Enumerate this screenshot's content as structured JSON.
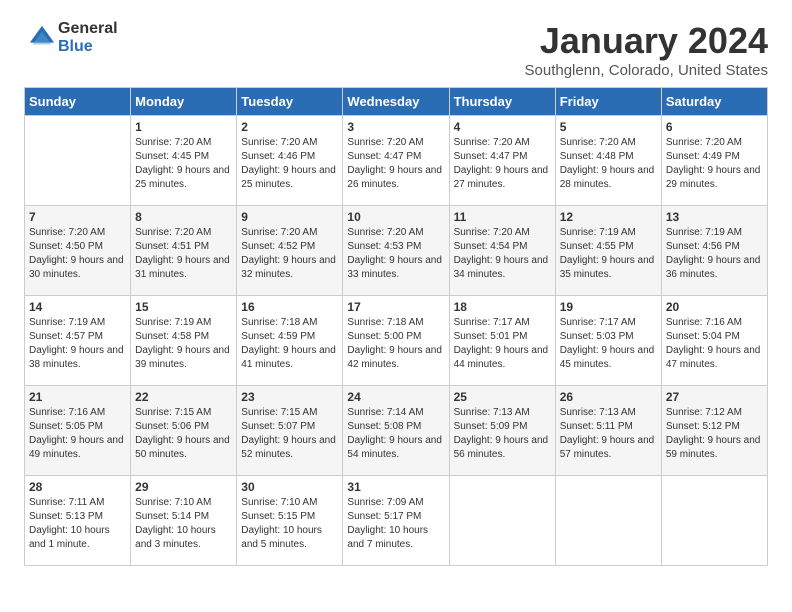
{
  "logo": {
    "general": "General",
    "blue": "Blue"
  },
  "header": {
    "month": "January 2024",
    "location": "Southglenn, Colorado, United States"
  },
  "weekdays": [
    "Sunday",
    "Monday",
    "Tuesday",
    "Wednesday",
    "Thursday",
    "Friday",
    "Saturday"
  ],
  "weeks": [
    [
      {
        "day": "",
        "sunrise": "",
        "sunset": "",
        "daylight": ""
      },
      {
        "day": "1",
        "sunrise": "Sunrise: 7:20 AM",
        "sunset": "Sunset: 4:45 PM",
        "daylight": "Daylight: 9 hours and 25 minutes."
      },
      {
        "day": "2",
        "sunrise": "Sunrise: 7:20 AM",
        "sunset": "Sunset: 4:46 PM",
        "daylight": "Daylight: 9 hours and 25 minutes."
      },
      {
        "day": "3",
        "sunrise": "Sunrise: 7:20 AM",
        "sunset": "Sunset: 4:47 PM",
        "daylight": "Daylight: 9 hours and 26 minutes."
      },
      {
        "day": "4",
        "sunrise": "Sunrise: 7:20 AM",
        "sunset": "Sunset: 4:47 PM",
        "daylight": "Daylight: 9 hours and 27 minutes."
      },
      {
        "day": "5",
        "sunrise": "Sunrise: 7:20 AM",
        "sunset": "Sunset: 4:48 PM",
        "daylight": "Daylight: 9 hours and 28 minutes."
      },
      {
        "day": "6",
        "sunrise": "Sunrise: 7:20 AM",
        "sunset": "Sunset: 4:49 PM",
        "daylight": "Daylight: 9 hours and 29 minutes."
      }
    ],
    [
      {
        "day": "7",
        "sunrise": "Sunrise: 7:20 AM",
        "sunset": "Sunset: 4:50 PM",
        "daylight": "Daylight: 9 hours and 30 minutes."
      },
      {
        "day": "8",
        "sunrise": "Sunrise: 7:20 AM",
        "sunset": "Sunset: 4:51 PM",
        "daylight": "Daylight: 9 hours and 31 minutes."
      },
      {
        "day": "9",
        "sunrise": "Sunrise: 7:20 AM",
        "sunset": "Sunset: 4:52 PM",
        "daylight": "Daylight: 9 hours and 32 minutes."
      },
      {
        "day": "10",
        "sunrise": "Sunrise: 7:20 AM",
        "sunset": "Sunset: 4:53 PM",
        "daylight": "Daylight: 9 hours and 33 minutes."
      },
      {
        "day": "11",
        "sunrise": "Sunrise: 7:20 AM",
        "sunset": "Sunset: 4:54 PM",
        "daylight": "Daylight: 9 hours and 34 minutes."
      },
      {
        "day": "12",
        "sunrise": "Sunrise: 7:19 AM",
        "sunset": "Sunset: 4:55 PM",
        "daylight": "Daylight: 9 hours and 35 minutes."
      },
      {
        "day": "13",
        "sunrise": "Sunrise: 7:19 AM",
        "sunset": "Sunset: 4:56 PM",
        "daylight": "Daylight: 9 hours and 36 minutes."
      }
    ],
    [
      {
        "day": "14",
        "sunrise": "Sunrise: 7:19 AM",
        "sunset": "Sunset: 4:57 PM",
        "daylight": "Daylight: 9 hours and 38 minutes."
      },
      {
        "day": "15",
        "sunrise": "Sunrise: 7:19 AM",
        "sunset": "Sunset: 4:58 PM",
        "daylight": "Daylight: 9 hours and 39 minutes."
      },
      {
        "day": "16",
        "sunrise": "Sunrise: 7:18 AM",
        "sunset": "Sunset: 4:59 PM",
        "daylight": "Daylight: 9 hours and 41 minutes."
      },
      {
        "day": "17",
        "sunrise": "Sunrise: 7:18 AM",
        "sunset": "Sunset: 5:00 PM",
        "daylight": "Daylight: 9 hours and 42 minutes."
      },
      {
        "day": "18",
        "sunrise": "Sunrise: 7:17 AM",
        "sunset": "Sunset: 5:01 PM",
        "daylight": "Daylight: 9 hours and 44 minutes."
      },
      {
        "day": "19",
        "sunrise": "Sunrise: 7:17 AM",
        "sunset": "Sunset: 5:03 PM",
        "daylight": "Daylight: 9 hours and 45 minutes."
      },
      {
        "day": "20",
        "sunrise": "Sunrise: 7:16 AM",
        "sunset": "Sunset: 5:04 PM",
        "daylight": "Daylight: 9 hours and 47 minutes."
      }
    ],
    [
      {
        "day": "21",
        "sunrise": "Sunrise: 7:16 AM",
        "sunset": "Sunset: 5:05 PM",
        "daylight": "Daylight: 9 hours and 49 minutes."
      },
      {
        "day": "22",
        "sunrise": "Sunrise: 7:15 AM",
        "sunset": "Sunset: 5:06 PM",
        "daylight": "Daylight: 9 hours and 50 minutes."
      },
      {
        "day": "23",
        "sunrise": "Sunrise: 7:15 AM",
        "sunset": "Sunset: 5:07 PM",
        "daylight": "Daylight: 9 hours and 52 minutes."
      },
      {
        "day": "24",
        "sunrise": "Sunrise: 7:14 AM",
        "sunset": "Sunset: 5:08 PM",
        "daylight": "Daylight: 9 hours and 54 minutes."
      },
      {
        "day": "25",
        "sunrise": "Sunrise: 7:13 AM",
        "sunset": "Sunset: 5:09 PM",
        "daylight": "Daylight: 9 hours and 56 minutes."
      },
      {
        "day": "26",
        "sunrise": "Sunrise: 7:13 AM",
        "sunset": "Sunset: 5:11 PM",
        "daylight": "Daylight: 9 hours and 57 minutes."
      },
      {
        "day": "27",
        "sunrise": "Sunrise: 7:12 AM",
        "sunset": "Sunset: 5:12 PM",
        "daylight": "Daylight: 9 hours and 59 minutes."
      }
    ],
    [
      {
        "day": "28",
        "sunrise": "Sunrise: 7:11 AM",
        "sunset": "Sunset: 5:13 PM",
        "daylight": "Daylight: 10 hours and 1 minute."
      },
      {
        "day": "29",
        "sunrise": "Sunrise: 7:10 AM",
        "sunset": "Sunset: 5:14 PM",
        "daylight": "Daylight: 10 hours and 3 minutes."
      },
      {
        "day": "30",
        "sunrise": "Sunrise: 7:10 AM",
        "sunset": "Sunset: 5:15 PM",
        "daylight": "Daylight: 10 hours and 5 minutes."
      },
      {
        "day": "31",
        "sunrise": "Sunrise: 7:09 AM",
        "sunset": "Sunset: 5:17 PM",
        "daylight": "Daylight: 10 hours and 7 minutes."
      },
      {
        "day": "",
        "sunrise": "",
        "sunset": "",
        "daylight": ""
      },
      {
        "day": "",
        "sunrise": "",
        "sunset": "",
        "daylight": ""
      },
      {
        "day": "",
        "sunrise": "",
        "sunset": "",
        "daylight": ""
      }
    ]
  ]
}
